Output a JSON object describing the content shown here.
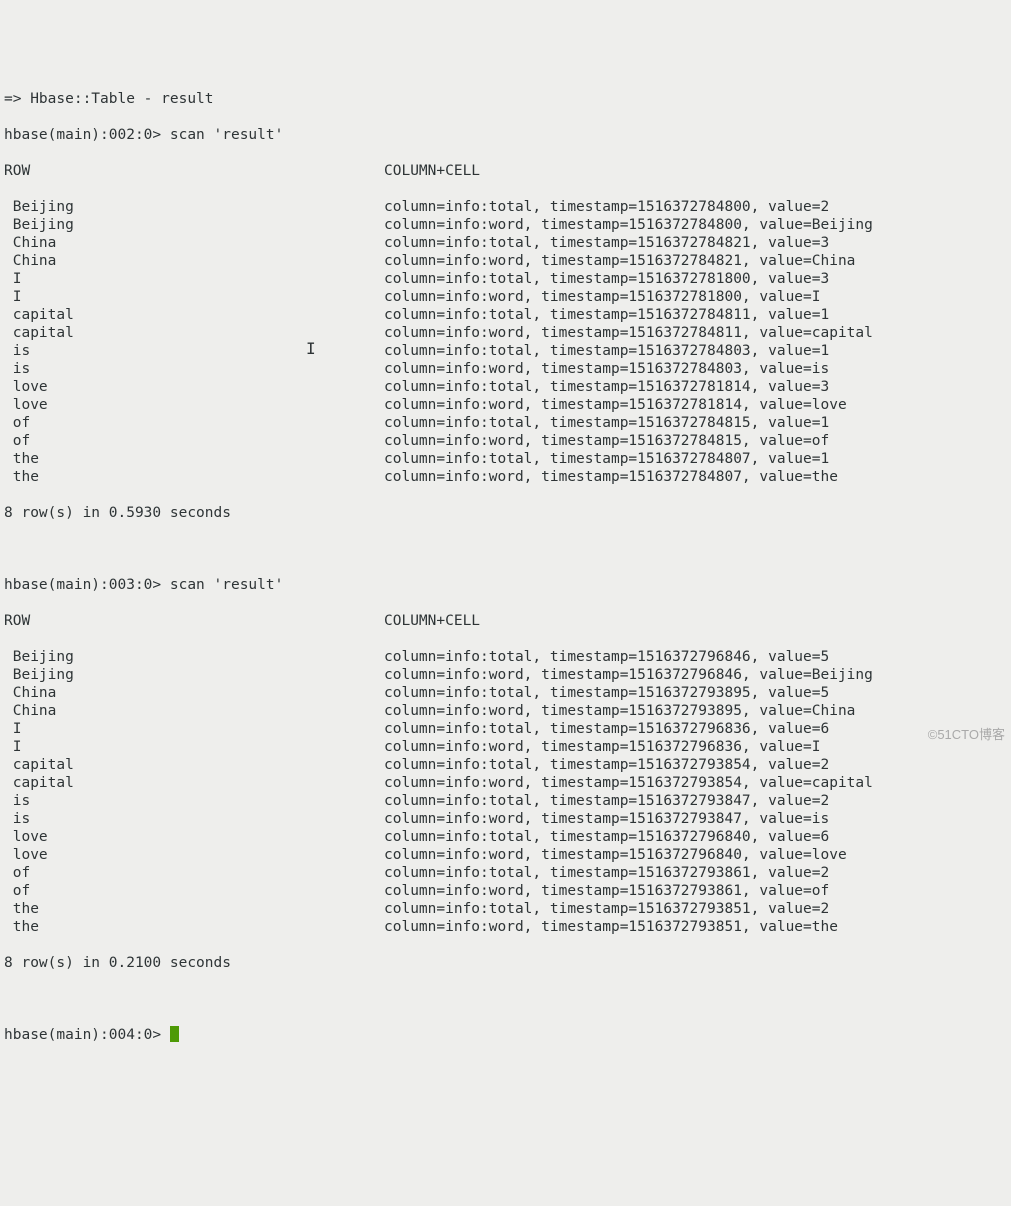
{
  "header": {
    "table_line": "=> Hbase::Table - result",
    "prompt_002": "hbase(main):002:0> scan 'result'",
    "row_header": "ROW",
    "col_header": "COLUMN+CELL"
  },
  "scan1": {
    "rows": [
      {
        "row": " Beijing",
        "cell": "column=info:total, timestamp=1516372784800, value=2"
      },
      {
        "row": " Beijing",
        "cell": "column=info:word, timestamp=1516372784800, value=Beijing"
      },
      {
        "row": " China",
        "cell": "column=info:total, timestamp=1516372784821, value=3"
      },
      {
        "row": " China",
        "cell": "column=info:word, timestamp=1516372784821, value=China"
      },
      {
        "row": " I",
        "cell": "column=info:total, timestamp=1516372781800, value=3"
      },
      {
        "row": " I",
        "cell": "column=info:word, timestamp=1516372781800, value=I"
      },
      {
        "row": " capital",
        "cell": "column=info:total, timestamp=1516372784811, value=1"
      },
      {
        "row": " capital",
        "cell": "column=info:word, timestamp=1516372784811, value=capital"
      },
      {
        "row": " is",
        "cell": "column=info:total, timestamp=1516372784803, value=1"
      },
      {
        "row": " is",
        "cell": "column=info:word, timestamp=1516372784803, value=is"
      },
      {
        "row": " love",
        "cell": "column=info:total, timestamp=1516372781814, value=3"
      },
      {
        "row": " love",
        "cell": "column=info:word, timestamp=1516372781814, value=love"
      },
      {
        "row": " of",
        "cell": "column=info:total, timestamp=1516372784815, value=1"
      },
      {
        "row": " of",
        "cell": "column=info:word, timestamp=1516372784815, value=of"
      },
      {
        "row": " the",
        "cell": "column=info:total, timestamp=1516372784807, value=1"
      },
      {
        "row": " the",
        "cell": "column=info:word, timestamp=1516372784807, value=the"
      }
    ],
    "footer": "8 row(s) in 0.5930 seconds"
  },
  "prompt_003": "hbase(main):003:0> scan 'result'",
  "scan2": {
    "rows": [
      {
        "row": " Beijing",
        "cell": "column=info:total, timestamp=1516372796846, value=5"
      },
      {
        "row": " Beijing",
        "cell": "column=info:word, timestamp=1516372796846, value=Beijing"
      },
      {
        "row": " China",
        "cell": "column=info:total, timestamp=1516372793895, value=5"
      },
      {
        "row": " China",
        "cell": "column=info:word, timestamp=1516372793895, value=China"
      },
      {
        "row": " I",
        "cell": "column=info:total, timestamp=1516372796836, value=6"
      },
      {
        "row": " I",
        "cell": "column=info:word, timestamp=1516372796836, value=I"
      },
      {
        "row": " capital",
        "cell": "column=info:total, timestamp=1516372793854, value=2"
      },
      {
        "row": " capital",
        "cell": "column=info:word, timestamp=1516372793854, value=capital"
      },
      {
        "row": " is",
        "cell": "column=info:total, timestamp=1516372793847, value=2"
      },
      {
        "row": " is",
        "cell": "column=info:word, timestamp=1516372793847, value=is"
      },
      {
        "row": " love",
        "cell": "column=info:total, timestamp=1516372796840, value=6"
      },
      {
        "row": " love",
        "cell": "column=info:word, timestamp=1516372796840, value=love"
      },
      {
        "row": " of",
        "cell": "column=info:total, timestamp=1516372793861, value=2"
      },
      {
        "row": " of",
        "cell": "column=info:word, timestamp=1516372793861, value=of"
      },
      {
        "row": " the",
        "cell": "column=info:total, timestamp=1516372793851, value=2"
      },
      {
        "row": " the",
        "cell": "column=info:word, timestamp=1516372793851, value=the"
      }
    ],
    "footer": "8 row(s) in 0.2100 seconds"
  },
  "prompt_004": "hbase(main):004:0> ",
  "watermark": "©51CTO博客"
}
